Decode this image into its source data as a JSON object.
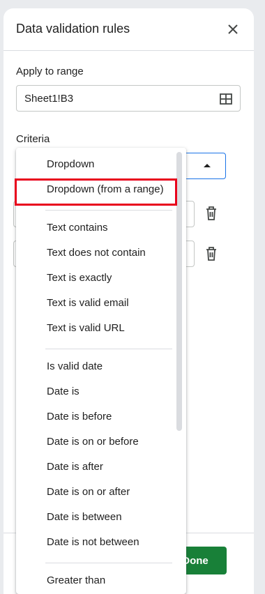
{
  "panel": {
    "title": "Data validation rules",
    "close_icon": "close-icon"
  },
  "apply_to_range": {
    "label": "Apply to range",
    "value": "Sheet1!B3",
    "icon": "grid-icon"
  },
  "criteria": {
    "label": "Criteria"
  },
  "menu": {
    "items": [
      {
        "label": "Dropdown"
      },
      {
        "label": "Dropdown (from a range)"
      },
      {
        "label": "Text contains"
      },
      {
        "label": "Text does not contain"
      },
      {
        "label": "Text is exactly"
      },
      {
        "label": "Text is valid email"
      },
      {
        "label": "Text is valid URL"
      },
      {
        "label": "Is valid date"
      },
      {
        "label": "Date is"
      },
      {
        "label": "Date is before"
      },
      {
        "label": "Date is on or before"
      },
      {
        "label": "Date is after"
      },
      {
        "label": "Date is on or after"
      },
      {
        "label": "Date is between"
      },
      {
        "label": "Date is not between"
      },
      {
        "label": "Greater than"
      }
    ]
  },
  "footer": {
    "done_label": "Done"
  },
  "colors": {
    "accent_blue": "#1a73e8",
    "done_green": "#188038",
    "highlight_red": "#e8001c"
  }
}
